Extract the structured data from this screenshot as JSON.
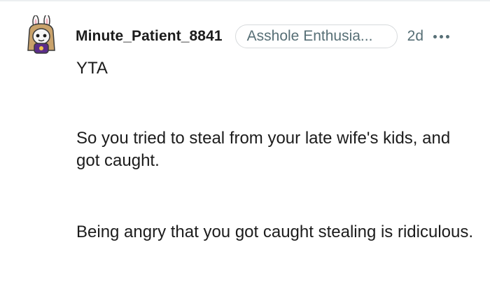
{
  "comment": {
    "author": "Minute_Patient_8841",
    "flair": "Asshole Enthusia...",
    "timestamp": "2d",
    "paragraphs": [
      "YTA",
      "So you tried to steal from your late wife's kids, and got caught.",
      "Being angry that you got caught stealing is ridiculous."
    ]
  },
  "icons": {
    "avatar": "snoo-avatar-bunny-ears",
    "more": "more-horizontal-icon"
  },
  "colors": {
    "text": "#1c1c1c",
    "meta": "#576f76",
    "border": "#d7dadc",
    "avatar_purple": "#5b2d8a"
  }
}
